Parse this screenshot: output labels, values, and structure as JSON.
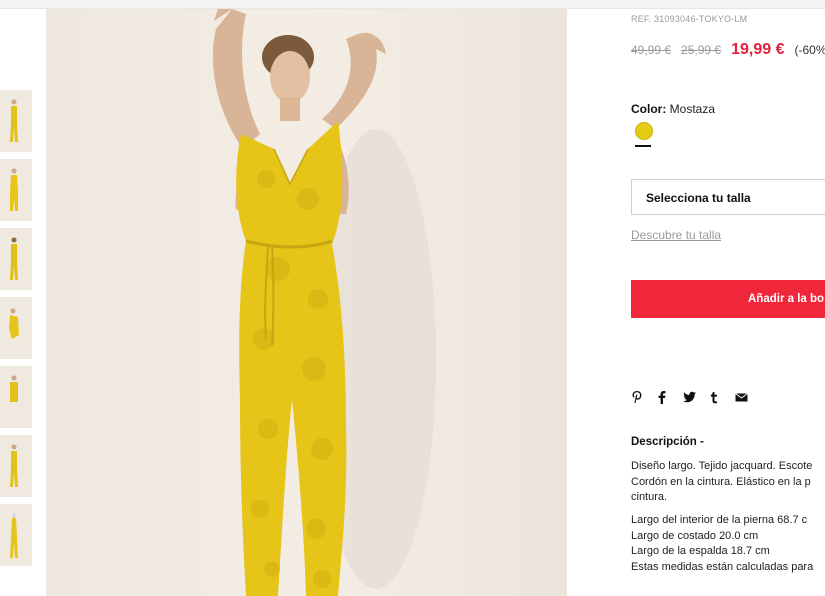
{
  "product": {
    "reference": "REF. 31093046-TOKYO-LM",
    "prices": {
      "original": "49,99 €",
      "previous": "25,99 €",
      "current": "19,99 €",
      "discount": "(-60%"
    },
    "color_label": "Color:",
    "color_value": "Mostaza",
    "swatch_color": "#e2cc14",
    "size_select_placeholder": "Selecciona tu talla",
    "size_guide_link": "Descubre tu talla",
    "add_to_bag_label": "Añadir a la bo",
    "share_icons": [
      "pinterest-icon",
      "facebook-icon",
      "twitter-icon",
      "tumblr-icon",
      "email-icon"
    ],
    "description_title": "Descripción -",
    "description_lines": [
      "Diseño largo. Tejido jacquard. Escote",
      "Cordón en la cintura. Elástico en la p",
      "cintura."
    ],
    "measure_lines": [
      "Largo del interior de la pierna 68.7 c",
      "Largo de costado 20.0 cm",
      "Largo de la espalda 18.7 cm",
      "Estas medidas están calculadas para"
    ]
  },
  "colors": {
    "accent_red": "#f0263a",
    "price_red": "#e0223a",
    "garment_yellow": "#e6c418"
  }
}
